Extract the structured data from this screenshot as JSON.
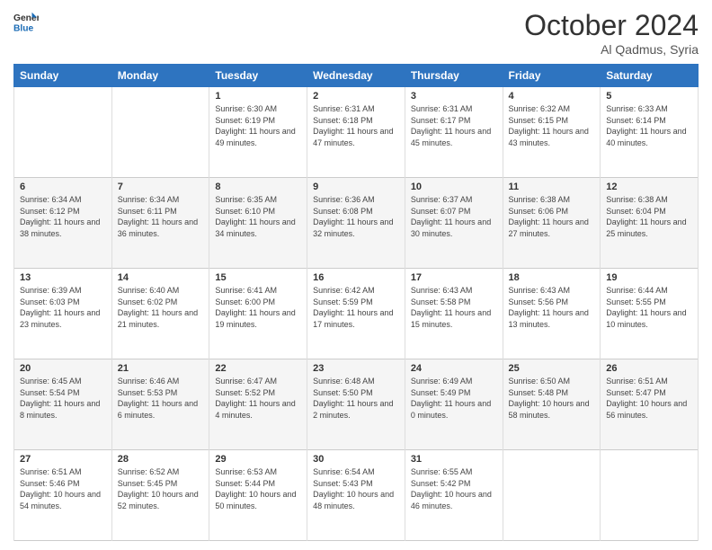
{
  "logo": {
    "line1": "General",
    "line2": "Blue"
  },
  "header": {
    "month": "October 2024",
    "location": "Al Qadmus, Syria"
  },
  "days_of_week": [
    "Sunday",
    "Monday",
    "Tuesday",
    "Wednesday",
    "Thursday",
    "Friday",
    "Saturday"
  ],
  "weeks": [
    [
      {
        "day": "",
        "info": ""
      },
      {
        "day": "",
        "info": ""
      },
      {
        "day": "1",
        "info": "Sunrise: 6:30 AM\nSunset: 6:19 PM\nDaylight: 11 hours and 49 minutes."
      },
      {
        "day": "2",
        "info": "Sunrise: 6:31 AM\nSunset: 6:18 PM\nDaylight: 11 hours and 47 minutes."
      },
      {
        "day": "3",
        "info": "Sunrise: 6:31 AM\nSunset: 6:17 PM\nDaylight: 11 hours and 45 minutes."
      },
      {
        "day": "4",
        "info": "Sunrise: 6:32 AM\nSunset: 6:15 PM\nDaylight: 11 hours and 43 minutes."
      },
      {
        "day": "5",
        "info": "Sunrise: 6:33 AM\nSunset: 6:14 PM\nDaylight: 11 hours and 40 minutes."
      }
    ],
    [
      {
        "day": "6",
        "info": "Sunrise: 6:34 AM\nSunset: 6:12 PM\nDaylight: 11 hours and 38 minutes."
      },
      {
        "day": "7",
        "info": "Sunrise: 6:34 AM\nSunset: 6:11 PM\nDaylight: 11 hours and 36 minutes."
      },
      {
        "day": "8",
        "info": "Sunrise: 6:35 AM\nSunset: 6:10 PM\nDaylight: 11 hours and 34 minutes."
      },
      {
        "day": "9",
        "info": "Sunrise: 6:36 AM\nSunset: 6:08 PM\nDaylight: 11 hours and 32 minutes."
      },
      {
        "day": "10",
        "info": "Sunrise: 6:37 AM\nSunset: 6:07 PM\nDaylight: 11 hours and 30 minutes."
      },
      {
        "day": "11",
        "info": "Sunrise: 6:38 AM\nSunset: 6:06 PM\nDaylight: 11 hours and 27 minutes."
      },
      {
        "day": "12",
        "info": "Sunrise: 6:38 AM\nSunset: 6:04 PM\nDaylight: 11 hours and 25 minutes."
      }
    ],
    [
      {
        "day": "13",
        "info": "Sunrise: 6:39 AM\nSunset: 6:03 PM\nDaylight: 11 hours and 23 minutes."
      },
      {
        "day": "14",
        "info": "Sunrise: 6:40 AM\nSunset: 6:02 PM\nDaylight: 11 hours and 21 minutes."
      },
      {
        "day": "15",
        "info": "Sunrise: 6:41 AM\nSunset: 6:00 PM\nDaylight: 11 hours and 19 minutes."
      },
      {
        "day": "16",
        "info": "Sunrise: 6:42 AM\nSunset: 5:59 PM\nDaylight: 11 hours and 17 minutes."
      },
      {
        "day": "17",
        "info": "Sunrise: 6:43 AM\nSunset: 5:58 PM\nDaylight: 11 hours and 15 minutes."
      },
      {
        "day": "18",
        "info": "Sunrise: 6:43 AM\nSunset: 5:56 PM\nDaylight: 11 hours and 13 minutes."
      },
      {
        "day": "19",
        "info": "Sunrise: 6:44 AM\nSunset: 5:55 PM\nDaylight: 11 hours and 10 minutes."
      }
    ],
    [
      {
        "day": "20",
        "info": "Sunrise: 6:45 AM\nSunset: 5:54 PM\nDaylight: 11 hours and 8 minutes."
      },
      {
        "day": "21",
        "info": "Sunrise: 6:46 AM\nSunset: 5:53 PM\nDaylight: 11 hours and 6 minutes."
      },
      {
        "day": "22",
        "info": "Sunrise: 6:47 AM\nSunset: 5:52 PM\nDaylight: 11 hours and 4 minutes."
      },
      {
        "day": "23",
        "info": "Sunrise: 6:48 AM\nSunset: 5:50 PM\nDaylight: 11 hours and 2 minutes."
      },
      {
        "day": "24",
        "info": "Sunrise: 6:49 AM\nSunset: 5:49 PM\nDaylight: 11 hours and 0 minutes."
      },
      {
        "day": "25",
        "info": "Sunrise: 6:50 AM\nSunset: 5:48 PM\nDaylight: 10 hours and 58 minutes."
      },
      {
        "day": "26",
        "info": "Sunrise: 6:51 AM\nSunset: 5:47 PM\nDaylight: 10 hours and 56 minutes."
      }
    ],
    [
      {
        "day": "27",
        "info": "Sunrise: 6:51 AM\nSunset: 5:46 PM\nDaylight: 10 hours and 54 minutes."
      },
      {
        "day": "28",
        "info": "Sunrise: 6:52 AM\nSunset: 5:45 PM\nDaylight: 10 hours and 52 minutes."
      },
      {
        "day": "29",
        "info": "Sunrise: 6:53 AM\nSunset: 5:44 PM\nDaylight: 10 hours and 50 minutes."
      },
      {
        "day": "30",
        "info": "Sunrise: 6:54 AM\nSunset: 5:43 PM\nDaylight: 10 hours and 48 minutes."
      },
      {
        "day": "31",
        "info": "Sunrise: 6:55 AM\nSunset: 5:42 PM\nDaylight: 10 hours and 46 minutes."
      },
      {
        "day": "",
        "info": ""
      },
      {
        "day": "",
        "info": ""
      }
    ]
  ]
}
